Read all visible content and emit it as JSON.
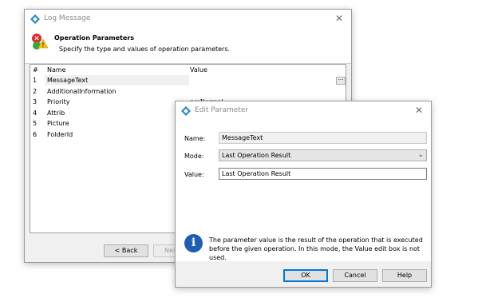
{
  "log_dialog": {
    "title": "Log Message",
    "header_title": "Operation Parameters",
    "header_subtitle": "Specify the type and values of operation parameters.",
    "columns": {
      "num": "#",
      "name": "Name",
      "value": "Value"
    },
    "rows": [
      {
        "num": "1",
        "name": "MessageText",
        "value": ""
      },
      {
        "num": "2",
        "name": "AdditionalInformation",
        "value": ""
      },
      {
        "num": "3",
        "name": "Priority",
        "value": "pmNormal"
      },
      {
        "num": "4",
        "name": "Attrib",
        "value": ""
      },
      {
        "num": "5",
        "name": "Picture",
        "value": ""
      },
      {
        "num": "6",
        "name": "FolderId",
        "value": ""
      }
    ],
    "ellipsis_label": "···",
    "back_label": "< Back",
    "next_label": "Next >"
  },
  "edit_dialog": {
    "title": "Edit Parameter",
    "name_label": "Name:",
    "name_value": "MessageText",
    "mode_label": "Mode:",
    "mode_value": "Last Operation Result",
    "value_label": "Value:",
    "value_value": "Last Operation Result",
    "info_text": "The parameter value is the result of the operation that is executed before the given operation. In this mode, the Value edit box is not used.",
    "ok_label": "OK",
    "cancel_label": "Cancel",
    "help_label": "Help"
  },
  "colors": {
    "accent": "#0078d7",
    "selected_row": "#f0f0f0",
    "info_icon": "#1e5fb4"
  }
}
